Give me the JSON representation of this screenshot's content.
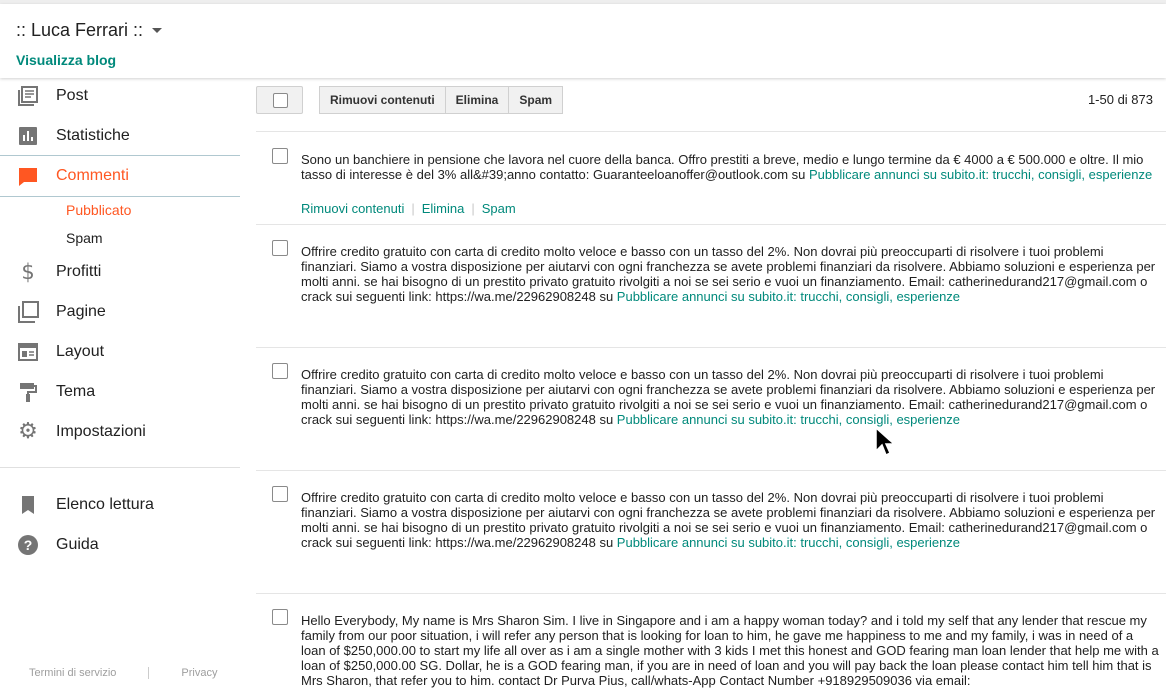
{
  "header": {
    "blog_name": ":: Luca Ferrari ::",
    "view_blog": "Visualizza blog"
  },
  "sidebar": {
    "items": [
      {
        "label": "Post",
        "icon": "posts-icon"
      },
      {
        "label": "Statistiche",
        "icon": "stats-icon"
      },
      {
        "label": "Commenti",
        "icon": "comments-icon",
        "active": true
      },
      {
        "label": "Profitti",
        "icon": "dollar-icon"
      },
      {
        "label": "Pagine",
        "icon": "pages-icon"
      },
      {
        "label": "Layout",
        "icon": "layout-icon"
      },
      {
        "label": "Tema",
        "icon": "paint-roller-icon"
      },
      {
        "label": "Impostazioni",
        "icon": "gear-icon"
      },
      {
        "label": "Elenco lettura",
        "icon": "bookmark-icon"
      },
      {
        "label": "Guida",
        "icon": "help-icon"
      }
    ],
    "subitems": [
      {
        "label": "Pubblicato",
        "active": true
      },
      {
        "label": "Spam"
      }
    ],
    "footer": {
      "terms": "Termini di servizio",
      "privacy": "Privacy"
    }
  },
  "toolbar": {
    "remove_content": "Rimuovi contenuti",
    "delete": "Elimina",
    "spam": "Spam",
    "range": "1-50 di 873"
  },
  "comments": [
    {
      "body": "Sono un banchiere in pensione che lavora nel cuore della banca. Offro prestiti a breve, medio e lungo termine da € 4000 a € 500.000 e oltre. Il mio tasso di interesse è del 3% all&#39;anno contatto: Guaranteeloanoffer@outlook.com su ",
      "post_link": "Pubblicare annunci su subito.it: trucchi, consigli, esperienze",
      "actions": {
        "remove": "Rimuovi contenuti",
        "delete": "Elimina",
        "spam": "Spam"
      }
    },
    {
      "body": "Offrire credito gratuito con carta di credito molto veloce e basso con un tasso del 2%. Non dovrai più preoccuparti di risolvere i tuoi problemi finanziari. Siamo a vostra disposizione per aiutarvi con ogni franchezza se avete problemi finanziari da risolvere. Abbiamo soluzioni e esperienza per molti anni. se hai bisogno di un prestito privato gratuito rivolgiti a noi se sei serio e vuoi un finanziamento. Email: catherinedurand217@gmail.com o crack sui seguenti link: https://wa.me/22962908248 su ",
      "post_link": "Pubblicare annunci su subito.it: trucchi, consigli, esperienze"
    },
    {
      "body": "Offrire credito gratuito con carta di credito molto veloce e basso con un tasso del 2%. Non dovrai più preoccuparti di risolvere i tuoi problemi finanziari. Siamo a vostra disposizione per aiutarvi con ogni franchezza se avete problemi finanziari da risolvere. Abbiamo soluzioni e esperienza per molti anni. se hai bisogno di un prestito privato gratuito rivolgiti a noi se sei serio e vuoi un finanziamento. Email: catherinedurand217@gmail.com o crack sui seguenti link: https://wa.me/22962908248 su ",
      "post_link": "Pubblicare annunci su subito.it: trucchi, consigli, esperienze"
    },
    {
      "body": "Offrire credito gratuito con carta di credito molto veloce e basso con un tasso del 2%. Non dovrai più preoccuparti di risolvere i tuoi problemi finanziari. Siamo a vostra disposizione per aiutarvi con ogni franchezza se avete problemi finanziari da risolvere. Abbiamo soluzioni e esperienza per molti anni. se hai bisogno di un prestito privato gratuito rivolgiti a noi se sei serio e vuoi un finanziamento. Email: catherinedurand217@gmail.com o crack sui seguenti link: https://wa.me/22962908248 su ",
      "post_link": "Pubblicare annunci su subito.it: trucchi, consigli, esperienze"
    },
    {
      "body": "Hello Everybody, My name is Mrs Sharon Sim. I live in Singapore and i am a happy woman today? and i told my self that any lender that rescue my family from our poor situation, i will refer any person that is looking for loan to him, he gave me happiness to me and my family, i was in need of a loan of $250,000.00 to start my life all over as i am a single mother with 3 kids I met this honest and GOD fearing man loan lender that help me with a loan of $250,000.00 SG. Dollar, he is a GOD fearing man, if you are in need of loan and you will pay back the loan please contact him tell him that is Mrs Sharon, that refer you to him. contact Dr Purva Pius, call/whats-App Contact Number +918929509036 via email:"
    }
  ],
  "colors": {
    "accent_orange": "#ff5722",
    "link_teal": "#00897b"
  }
}
